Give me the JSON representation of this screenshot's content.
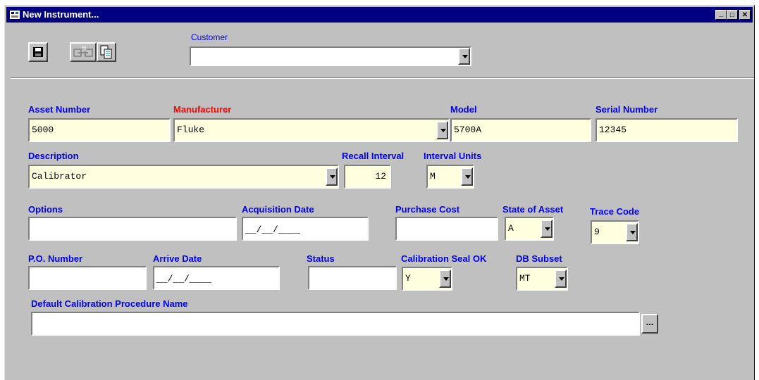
{
  "window": {
    "title": "New Instrument...",
    "minimize": "_",
    "maximize": "□",
    "close": "✕"
  },
  "toolbar": {
    "save_icon": "floppy-disk-icon",
    "link_icon": "link-icon",
    "copy_icon": "document-copy-icon"
  },
  "customer": {
    "label": "Customer",
    "value": ""
  },
  "fields": {
    "asset_number": {
      "label": "Asset Number",
      "value": "5000"
    },
    "manufacturer": {
      "label": "Manufacturer",
      "value": "Fluke"
    },
    "model": {
      "label": "Model",
      "value": "5700A"
    },
    "serial_number": {
      "label": "Serial Number",
      "value": "12345"
    },
    "description": {
      "label": "Description",
      "value": "Calibrator"
    },
    "recall_interval": {
      "label": "Recall Interval",
      "value": "12"
    },
    "interval_units": {
      "label": "Interval Units",
      "value": "M"
    },
    "options": {
      "label": "Options",
      "value": ""
    },
    "acquisition_date": {
      "label": "Acquisition Date",
      "value": "__/__/____"
    },
    "purchase_cost": {
      "label": "Purchase Cost",
      "value": ""
    },
    "state_of_asset": {
      "label": "State of Asset",
      "value": "A"
    },
    "trace_code": {
      "label": "Trace Code",
      "value": "9"
    },
    "po_number": {
      "label": "P.O. Number",
      "value": ""
    },
    "arrive_date": {
      "label": "Arrive Date",
      "value": "__/__/____"
    },
    "status": {
      "label": "Status",
      "value": ""
    },
    "calibration_seal_ok": {
      "label": "Calibration Seal OK",
      "value": "Y"
    },
    "db_subset": {
      "label": "DB Subset",
      "value": "MT"
    },
    "default_procedure": {
      "label": "Default Calibration Procedure Name",
      "value": "",
      "browse": "..."
    }
  },
  "colors": {
    "title_bar": "#000080",
    "required_field": "#ffffe0",
    "label_blue": "#0000ff",
    "label_red": "#ff0000"
  }
}
